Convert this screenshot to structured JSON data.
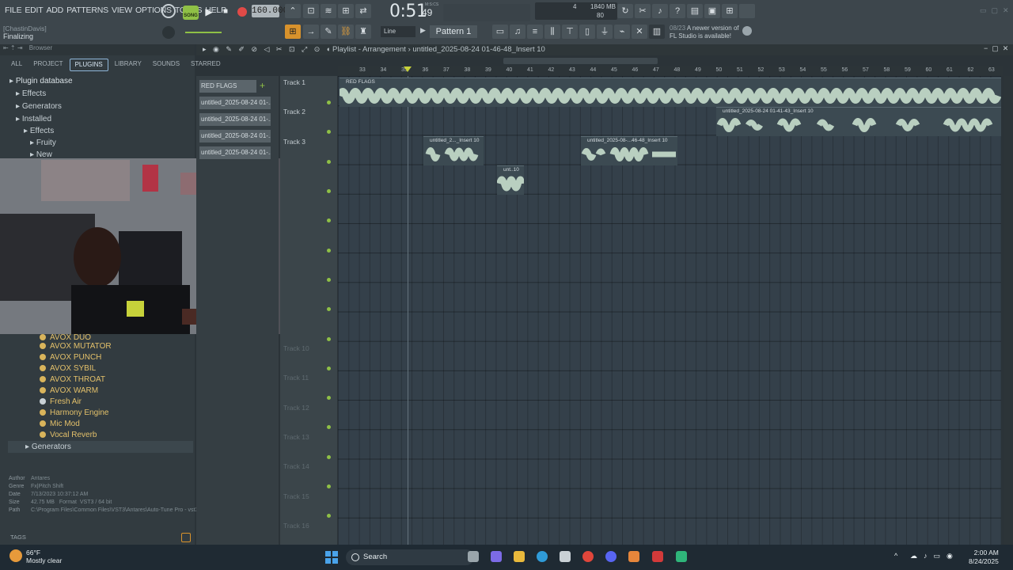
{
  "menu": [
    "FILE",
    "EDIT",
    "ADD",
    "PATTERNS",
    "VIEW",
    "OPTIONS",
    "TOOLS",
    "HELP"
  ],
  "hint": {
    "user": "[ChastinDavis]",
    "status": "Finalizing"
  },
  "transport": {
    "song_label": "SONG",
    "tempo": "160.000",
    "time_main": "0:51",
    "time_sub": "49",
    "time_label": "M:S:CS"
  },
  "monitor": {
    "cpu": "4",
    "mem": "1840 MB",
    "mem2": "80"
  },
  "pattern": {
    "label": "Pattern 1",
    "snap": "Line"
  },
  "notice": {
    "date": "08/23",
    "line1": "A newer version of",
    "line2": "FL Studio is available!"
  },
  "browser": {
    "header": "Browser",
    "tabs": [
      "ALL",
      "PROJECT",
      "PLUGINS",
      "LIBRARY",
      "SOUNDS",
      "STARRED"
    ],
    "active_tab": "PLUGINS",
    "tree": [
      "Plugin database",
      "Effects",
      "Generators",
      "Installed",
      "Effects",
      "Fruity",
      "New"
    ],
    "plugins": [
      "AVOX DUO",
      "AVOX MUTATOR",
      "AVOX PUNCH",
      "AVOX SYBIL",
      "AVOX THROAT",
      "AVOX WARM",
      "Fresh Air",
      "Harmony Engine",
      "Mic Mod",
      "Vocal Reverb"
    ],
    "generators": "Generators",
    "meta": {
      "author_k": "Author",
      "author": "Antares",
      "genre_k": "Genre",
      "genre": "Fx|Pitch Shift",
      "date_k": "Date",
      "date": "7/13/2023 10:37:12 AM",
      "size_k": "Size",
      "size": "42.75 MB",
      "format_k": "Format",
      "format": "VST3 / 64 bit",
      "path_k": "Path",
      "path": "C:\\Program Files\\Common Files\\VST3\\Antares\\Auto-Tune Pro - vst3"
    },
    "tags": "TAGS"
  },
  "playlist": {
    "title": "Playlist - Arrangement",
    "breadcrumb": "untitled_2025-08-24 01-46-48_Insert 10",
    "clip_list": [
      "RED FLAGS",
      "untitled_2025-08-24 01-...",
      "untitled_2025-08-24 01-...",
      "untitled_2025-08-24 01-...",
      "untitled_2025-08-24 01-..."
    ],
    "tracks": [
      "Track 1",
      "Track 2",
      "Track 3",
      "Track 10",
      "Track 11",
      "Track 12",
      "Track 13",
      "Track 14",
      "Track 15",
      "Track 16"
    ],
    "ruler": [
      "33",
      "34",
      "35",
      "36",
      "37",
      "38",
      "39",
      "40",
      "41",
      "42",
      "43",
      "44",
      "45",
      "46",
      "47",
      "48",
      "49",
      "50",
      "51",
      "52",
      "53",
      "54",
      "55",
      "56",
      "57",
      "58",
      "59",
      "60",
      "61",
      "62",
      "63"
    ],
    "clips": {
      "c1": "RED FLAGS",
      "c2": "untitled_2025-08-24 01-41-43_Insert 10",
      "c3": "untitled_2..._Insert 10",
      "c4": "untitled_2025-08-...46-48_Insert 10",
      "c5": "unt..10"
    }
  },
  "taskbar": {
    "temp": "66°F",
    "weather": "Mostly clear",
    "search": "Search",
    "time": "2:00 AM",
    "date": "8/24/2025"
  }
}
